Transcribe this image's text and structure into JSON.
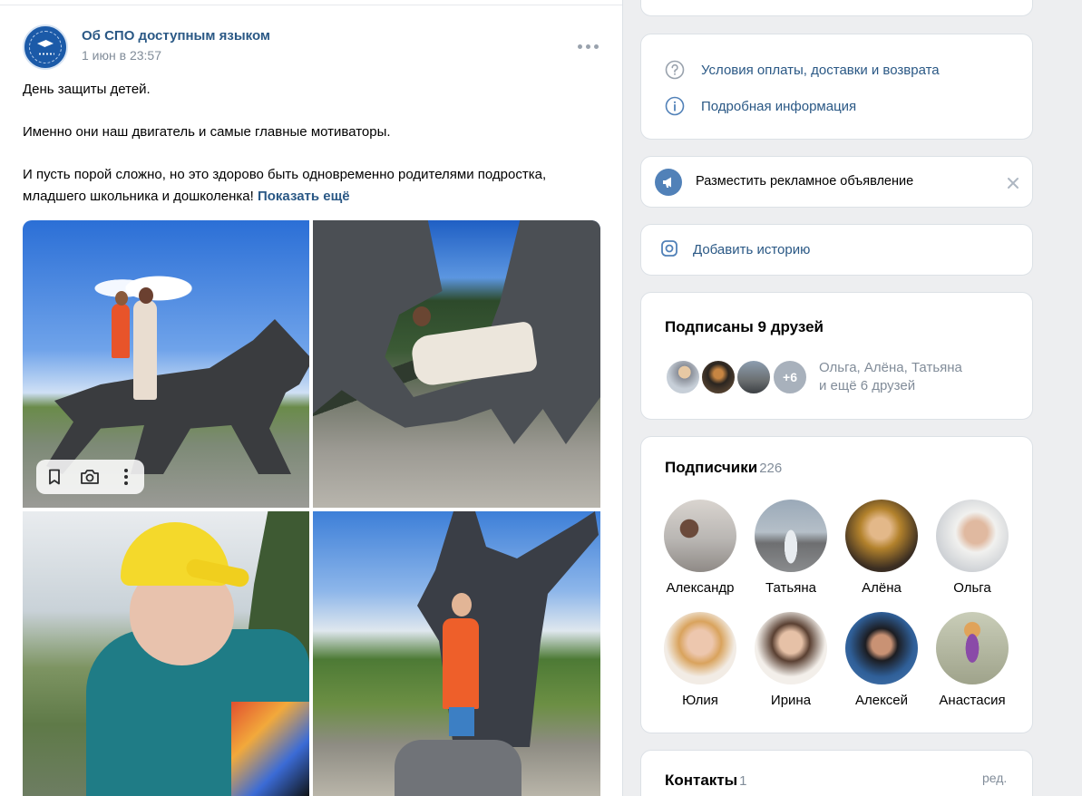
{
  "post": {
    "author": "Об СПО доступным языком",
    "date": "1 июн в 23:57",
    "paragraphs": [
      "День защиты детей.",
      "Именно они наш двигатель и самые главные мотиваторы."
    ],
    "last_paragraph": "И пусть порой сложно, но это здорово быть одновременно родителями подростка, младшего школьника и дошколенка!",
    "show_more": "Показать ещё",
    "icons": {
      "more": "more-horizontal-icon",
      "bookmark": "bookmark-icon",
      "camera": "camera-icon",
      "menu": "more-vertical-icon"
    }
  },
  "sidebar": {
    "info_links": [
      {
        "label": "Условия оплаты, доставки и возврата",
        "icon": "question-circle-icon"
      },
      {
        "label": "Подробная информация",
        "icon": "info-circle-icon"
      }
    ],
    "ad": {
      "label": "Разместить рекламное объявление",
      "icon": "megaphone-icon"
    },
    "story": {
      "label": "Добавить историю",
      "icon": "story-camera-icon"
    },
    "friends": {
      "title": "Подписаны 9 друзей",
      "more_badge": "+6",
      "names_line1": "Ольга, Алёна, Татьяна",
      "names_line2": "и ещё 6 друзей"
    },
    "subscribers": {
      "title": "Подписчики",
      "count": "226",
      "people": [
        {
          "name": "Александр"
        },
        {
          "name": "Татьяна"
        },
        {
          "name": "Алёна"
        },
        {
          "name": "Ольга"
        },
        {
          "name": "Юлия"
        },
        {
          "name": "Ирина"
        },
        {
          "name": "Алексей"
        },
        {
          "name": "Анастасия"
        }
      ]
    },
    "contacts": {
      "title": "Контакты",
      "count": "1",
      "edit": "ред."
    }
  },
  "colors": {
    "link": "#2a5885",
    "muted": "#818c99",
    "accent": "#5181b8",
    "background": "#edeef0"
  }
}
